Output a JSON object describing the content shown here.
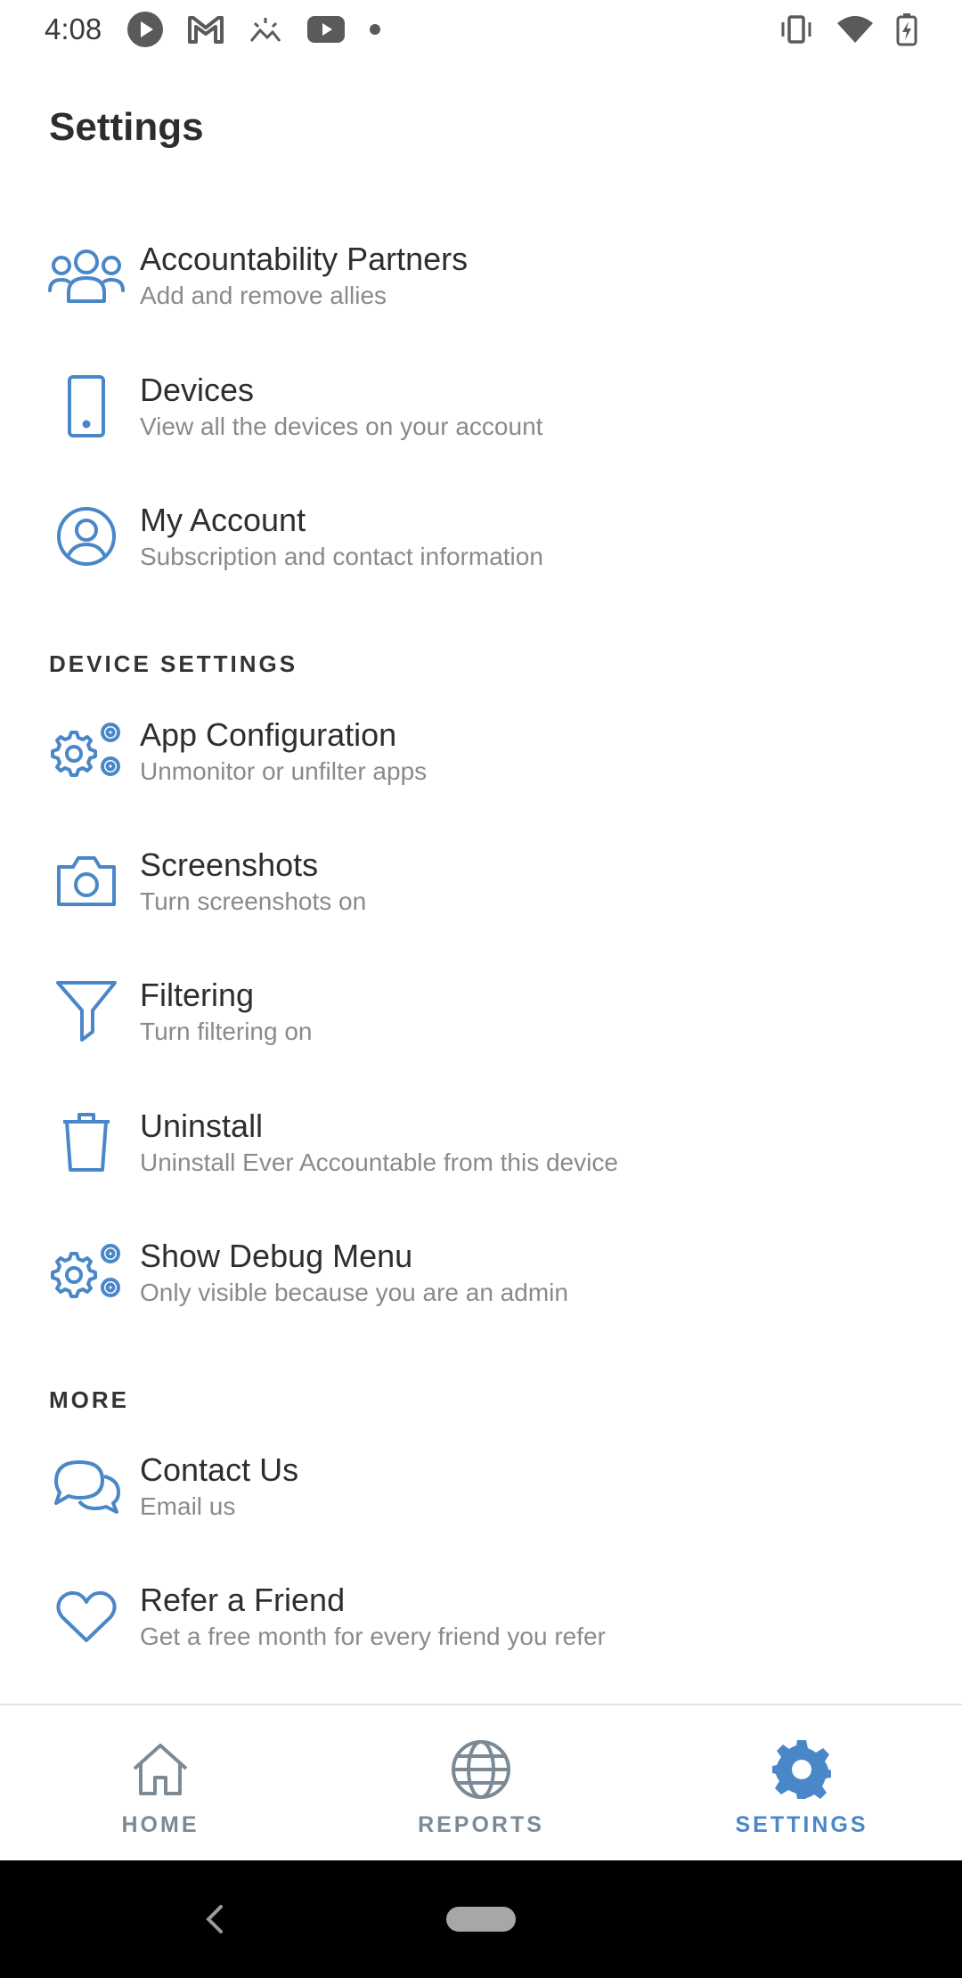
{
  "status_bar": {
    "time": "4:08",
    "left_icons": [
      "play-icon",
      "gmail-icon",
      "weather-icon",
      "youtube-icon",
      "dot-icon"
    ],
    "right_icons": [
      "vibrate-icon",
      "wifi-icon",
      "battery-icon"
    ]
  },
  "header": {
    "title": "Settings"
  },
  "accent_color": "#4a87c8",
  "items": {
    "accountability": {
      "title": "Accountability Partners",
      "subtitle": "Add and remove allies",
      "icon": "people-icon"
    },
    "devices": {
      "title": "Devices",
      "subtitle": "View all the devices on your account",
      "icon": "phone-icon"
    },
    "my_account": {
      "title": "My Account",
      "subtitle": "Subscription and contact information",
      "icon": "user-circle-icon"
    },
    "app_configuration": {
      "title": "App Configuration",
      "subtitle": "Unmonitor or unfilter apps",
      "icon": "gears-icon"
    },
    "screenshots": {
      "title": "Screenshots",
      "subtitle": "Turn screenshots on",
      "icon": "camera-icon"
    },
    "filtering": {
      "title": "Filtering",
      "subtitle": "Turn filtering on",
      "icon": "filter-icon"
    },
    "uninstall": {
      "title": "Uninstall",
      "subtitle": "Uninstall Ever Accountable from this device",
      "icon": "trash-icon"
    },
    "debug_menu": {
      "title": "Show Debug Menu",
      "subtitle": "Only visible because you are an admin",
      "icon": "gears-icon"
    },
    "contact_us": {
      "title": "Contact Us",
      "subtitle": "Email us",
      "icon": "chat-icon"
    },
    "refer_friend": {
      "title": "Refer a Friend",
      "subtitle": "Get a free month for every friend you refer",
      "icon": "heart-icon"
    }
  },
  "sections": {
    "device_settings": "DEVICE SETTINGS",
    "more": "MORE"
  },
  "bottom_nav": {
    "home": {
      "label": "HOME",
      "icon": "home-icon"
    },
    "reports": {
      "label": "REPORTS",
      "icon": "globe-icon"
    },
    "settings": {
      "label": "SETTINGS",
      "icon": "gear-icon",
      "active": true
    },
    "inactive_color": "#7c8a96",
    "active_color": "#4a87c8"
  }
}
